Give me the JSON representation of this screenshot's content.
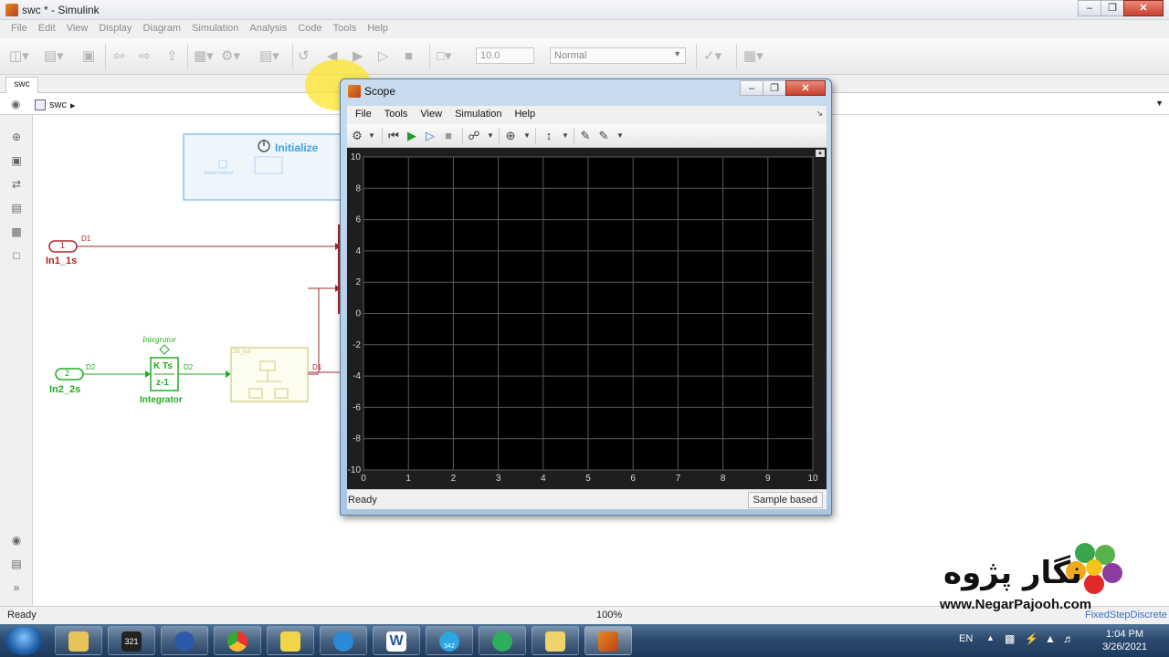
{
  "window": {
    "title": "swc * - Simulink"
  },
  "menu": [
    "File",
    "Edit",
    "View",
    "Display",
    "Diagram",
    "Simulation",
    "Analysis",
    "Code",
    "Tools",
    "Help"
  ],
  "toolbar": {
    "stop_time": "10.0",
    "sim_mode": "Normal"
  },
  "tab": {
    "label": "swc"
  },
  "breadcrumb": {
    "model": "swc"
  },
  "diagram": {
    "init_label": "Initialize",
    "init_inner": "Event Listener",
    "in1_number": "1",
    "in1_name": "In1_1s",
    "in1_signal": "D1",
    "in2_number": "2",
    "in2_name": "In2_2s",
    "in2_signal": "D2",
    "integrator_title": "Integrator",
    "integrator_num": "K Ts",
    "integrator_den": "z-1",
    "integrator_name": "Integrator",
    "integrator_out_signal": "D2",
    "sub_label": "Db_but",
    "sub_out_signal": "D1"
  },
  "status": {
    "left": "Ready",
    "zoom": "100%",
    "solver": "FixedStepDiscrete"
  },
  "scope": {
    "title": "Scope",
    "menu": [
      "File",
      "Tools",
      "View",
      "Simulation",
      "Help"
    ],
    "status_left": "Ready",
    "status_right": "Sample based"
  },
  "chart_data": {
    "type": "line",
    "title": "",
    "xlabel": "",
    "ylabel": "",
    "xlim": [
      0,
      10
    ],
    "ylim": [
      -10,
      10
    ],
    "x_ticks": [
      "0",
      "1",
      "2",
      "3",
      "4",
      "5",
      "6",
      "7",
      "8",
      "9",
      "10"
    ],
    "y_ticks": [
      "10",
      "8",
      "6",
      "4",
      "2",
      "0",
      "-2",
      "-4",
      "-6",
      "-8",
      "-10"
    ],
    "grid": true,
    "series": []
  },
  "taskbar": {
    "lang": "EN",
    "time": "1:04 PM",
    "date": "3/26/2021",
    "badge_321": "321",
    "badge_telegram": "542"
  },
  "watermark": {
    "text": "نگار پژوه",
    "url": "www.NegarPajooh.com"
  }
}
